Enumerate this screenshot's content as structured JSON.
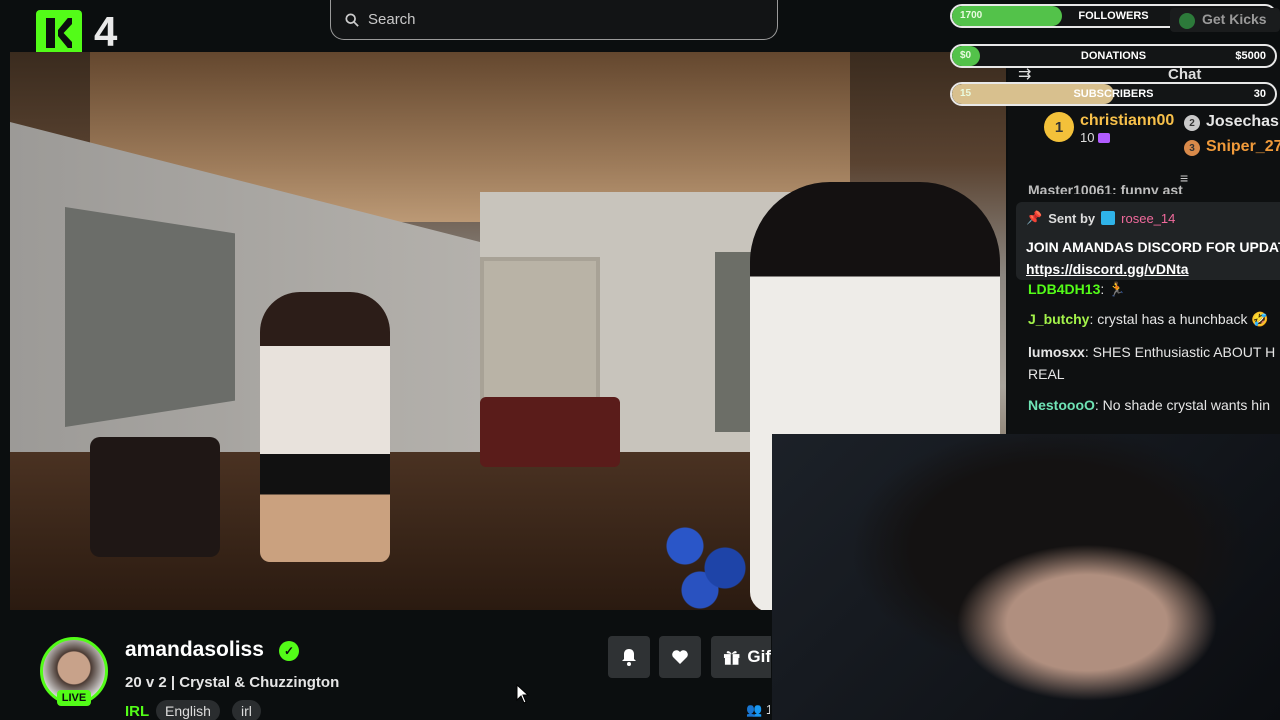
{
  "header": {
    "brand_number": "4",
    "search_placeholder": "Search"
  },
  "goals": [
    {
      "current": "1700",
      "label": "FOLLOWERS",
      "max": "5000",
      "progress": 0.34,
      "color": "#53c24a"
    },
    {
      "current": "$0",
      "label": "DONATIONS",
      "max": "$5000",
      "progress": 0.0,
      "color": "#53c24a"
    },
    {
      "current": "15",
      "label": "SUBSCRIBERS",
      "max": "30",
      "progress": 0.5,
      "color": "#d8c08e"
    }
  ],
  "get_kicks": "Get Kicks",
  "chat": {
    "title": "Chat",
    "leaderboard": [
      {
        "rank": "1",
        "name": "christiann00",
        "count": "10"
      },
      {
        "rank": "2",
        "name": "Josechasi"
      },
      {
        "rank": "3",
        "name": "Sniper_27"
      }
    ],
    "top_clipped": "Master10061: funny ast",
    "pinned": {
      "sent_by_label": "Sent by",
      "user": "rosee_14",
      "message": "JOIN AMANDAS DISCORD FOR UPDATES",
      "link": "https://discord.gg/vDNta"
    },
    "messages": [
      {
        "user": "LDB4DH13",
        "text": "🏃",
        "color": "#53fc18"
      },
      {
        "user": "J_butchy",
        "text": "crystal has a hunchback 🤣",
        "color": "#a3f24a"
      },
      {
        "user": "lumosxx",
        "text": "SHES Enthusiastic ABOUT H",
        "cont": "REAL",
        "color": "#e6e6e6"
      },
      {
        "user": "NestoooO",
        "text": "No shade crystal wants hin",
        "color": "#6fe3b5"
      }
    ]
  },
  "channel": {
    "username": "amandasoliss",
    "live_label": "LIVE",
    "stream_title": "20 v 2 | Crystal & Chuzzington",
    "category": "IRL",
    "tags": [
      "English",
      "irl"
    ],
    "gift_label": "Gif",
    "viewers": "1"
  }
}
